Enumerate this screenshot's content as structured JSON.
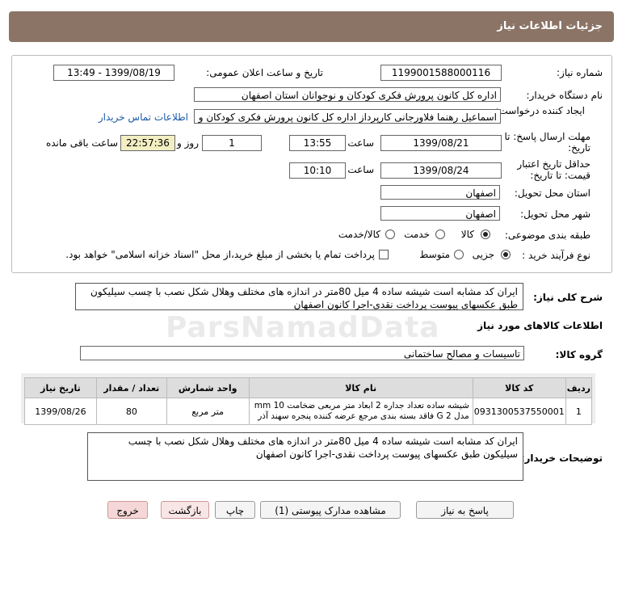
{
  "header": {
    "title": "جزئیات اطلاعات نیاز"
  },
  "form": {
    "need_number_label": "شماره نیاز:",
    "need_number": "1199001588000116",
    "announce_label": "تاریخ و ساعت اعلان عمومی:",
    "announce_value": "1399/08/19 - 13:49",
    "buyer_org_label": "نام دستگاه خریدار:",
    "buyer_org": "اداره کل کانون پرورش فکری کودکان و نوجوانان استان اصفهان",
    "creator_label": "ایجاد کننده درخواست:",
    "creator": "اسماعیل رهنما فلاورجانی کارپرداز اداره کل کانون پرورش فکری کودکان و نوجوانا",
    "contact_link": "اطلاعات تماس خریدار",
    "reply_deadline_label": "مهلت ارسال پاسخ: تا تاریخ:",
    "reply_date": "1399/08/21",
    "time_label": "ساعت",
    "reply_time": "13:55",
    "days_value": "1",
    "days_label": "روز و",
    "remaining_time": "22:57:36",
    "remaining_label": "ساعت باقی مانده",
    "price_deadline_label": "حداقل تاریخ اعتبار قیمت: تا تاریخ:",
    "price_date": "1399/08/24",
    "price_time": "10:10",
    "province_label": "استان محل تحویل:",
    "province": "اصفهان",
    "city_label": "شهر محل تحویل:",
    "city": "اصفهان",
    "category_label": "طبقه بندی موضوعی:",
    "category_options": [
      "کالا",
      "خدمت",
      "کالا/خدمت"
    ],
    "process_label": "نوع فرآیند خرید :",
    "process_options": [
      "جزیی",
      "متوسط"
    ],
    "payment_note": "پرداخت تمام یا بخشی از مبلغ خرید،از محل \"اسناد خزانه اسلامی\" خواهد بود."
  },
  "summary": {
    "label": "شرح کلی نیاز:",
    "text": "ایران کد مشابه است شیشه ساده 4 میل 80متر در اندازه های مختلف وهلال شکل  نصب با چسب سیلیکون طبق عکسهای پیوست پرداخت نقدی-اجرا کانون اصفهان"
  },
  "items_section": {
    "title": "اطلاعات کالاهای مورد نیاز",
    "group_label": "گروه کالا:",
    "group_value": "تاسیسات و مصالح ساختمانی",
    "columns": [
      "ردیف",
      "کد کالا",
      "نام کالا",
      "واحد شمارش",
      "تعداد / مقدار",
      "تاریخ نیاز"
    ],
    "rows": [
      {
        "row": "1",
        "code": "0931300537550001",
        "name": "شیشه ساده تعداد جداره 2 ابعاد متر مربعی ضخامت 10 mm مدل G 2 فاقد بسته بندی مرجع عرضه کننده پنجره سهند آذر",
        "unit": "متر مربع",
        "qty": "80",
        "date": "1399/08/26"
      }
    ]
  },
  "buyer_notes": {
    "label": "توضیحات خریدار:",
    "text": "ایران کد مشابه است شیشه ساده 4 میل 80متر در اندازه های مختلف وهلال شکل  نصب با چسب سیلیکون طبق عکسهای پیوست پرداخت نقدی-اجرا کانون اصفهان"
  },
  "buttons": {
    "reply": "پاسخ به نیاز",
    "attachments": "مشاهده مدارک پیوستی (1)",
    "print": "چاپ",
    "back": "بازگشت",
    "exit": "خروج"
  },
  "watermark": "ParsNamadData"
}
